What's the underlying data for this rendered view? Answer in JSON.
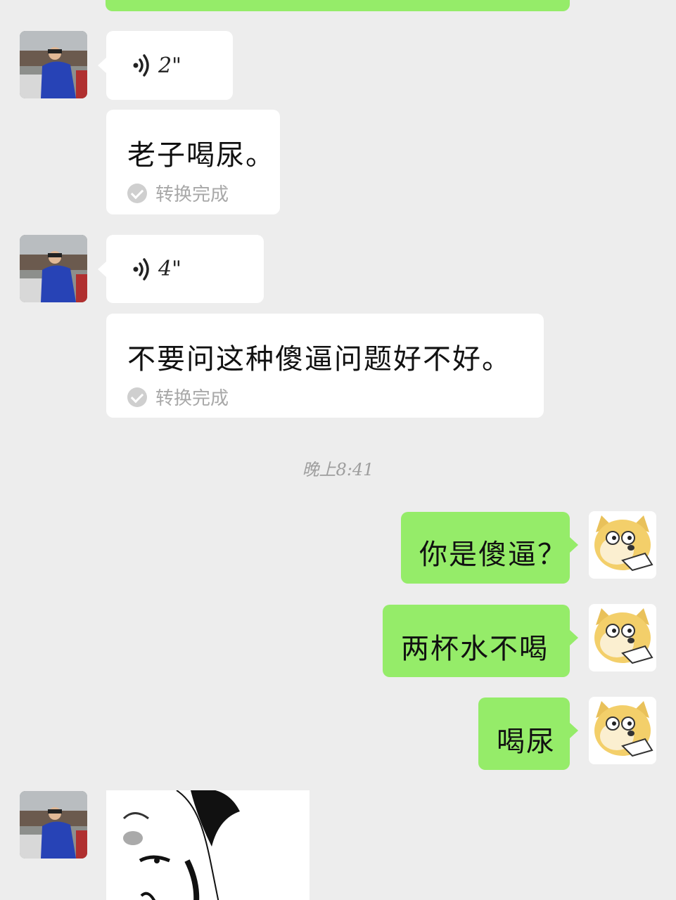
{
  "messages": [
    {
      "id": "voice1",
      "duration": "2\""
    },
    {
      "id": "transcript1",
      "text": "老子喝尿。",
      "status": "转换完成"
    },
    {
      "id": "voice2",
      "duration": "4\""
    },
    {
      "id": "transcript2",
      "text": "不要问这种傻逼问题好不好。",
      "status": "转换完成"
    },
    {
      "id": "out1",
      "text": "你是傻逼？"
    },
    {
      "id": "out2",
      "text": "两杯水不喝"
    },
    {
      "id": "out3",
      "text": "喝尿"
    }
  ],
  "timestamp": "晚上8:41",
  "colors": {
    "background": "#ededed",
    "incoming_bubble": "#ffffff",
    "outgoing_bubble": "#95ec69"
  },
  "icons": {
    "voice": "voice-wave-icon",
    "converted": "check-circle-icon"
  }
}
